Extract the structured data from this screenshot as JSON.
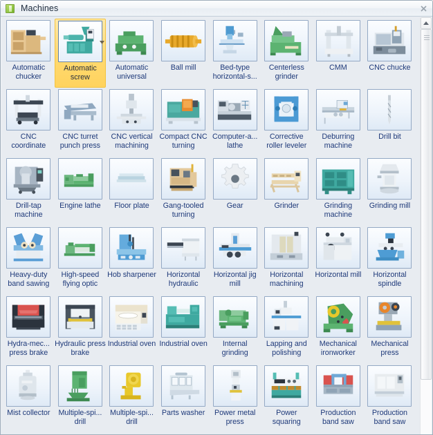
{
  "window": {
    "title": "Machines",
    "title_icon": "stencil-icon",
    "close_label": "close-icon"
  },
  "scrollbar": {
    "up_arrow": "scroll-up-icon",
    "thumb_grip": "scrollbar-grip"
  },
  "selection": {
    "selected_index": 1,
    "selected_label": "Automatic screw",
    "highlight_color": "#ffd970",
    "dropdown_arrow": "chevron-down-icon"
  },
  "colors": {
    "caption_text": "#1f3a7a",
    "panel_background": "#e8ecf1",
    "thumb_border": "#93a8c4",
    "title_text": "#1d2b3c"
  },
  "grid": {
    "columns": 8,
    "items": [
      {
        "label": "Automatic chucker",
        "icon": "automatic-chucker"
      },
      {
        "label": "Automatic screw",
        "icon": "automatic-screw"
      },
      {
        "label": "Automatic universal",
        "icon": "automatic-universal"
      },
      {
        "label": "Ball mill",
        "icon": "ball-mill"
      },
      {
        "label": "Bed-type horizontal-s...",
        "icon": "bed-type-horizontal"
      },
      {
        "label": "Centerless grinder",
        "icon": "centerless-grinder"
      },
      {
        "label": "CMM",
        "icon": "cmm"
      },
      {
        "label": "CNC chucke",
        "icon": "cnc-chucker"
      },
      {
        "label": "CNC coordinate",
        "icon": "cnc-coordinate"
      },
      {
        "label": "CNC turret punch press",
        "icon": "cnc-turret-punch-press"
      },
      {
        "label": "CNC vertical machining",
        "icon": "cnc-vertical-machining"
      },
      {
        "label": "Compact CNC turning",
        "icon": "compact-cnc-turning"
      },
      {
        "label": "Computer-a... lathe",
        "icon": "computer-aided-lathe"
      },
      {
        "label": "Corrective roller leveler",
        "icon": "corrective-roller-leveler"
      },
      {
        "label": "Deburring machine",
        "icon": "deburring-machine"
      },
      {
        "label": "Drill bit",
        "icon": "drill-bit"
      },
      {
        "label": "Drill-tap machine",
        "icon": "drill-tap-machine"
      },
      {
        "label": "Engine lathe",
        "icon": "engine-lathe"
      },
      {
        "label": "Floor plate",
        "icon": "floor-plate"
      },
      {
        "label": "Gang-tooled turning",
        "icon": "gang-tooled-turning"
      },
      {
        "label": "Gear",
        "icon": "gear"
      },
      {
        "label": "Grinder",
        "icon": "grinder"
      },
      {
        "label": "Grinding machine",
        "icon": "grinding-machine"
      },
      {
        "label": "Grinding mill",
        "icon": "grinding-mill"
      },
      {
        "label": "Heavy-duty band sawing",
        "icon": "heavy-duty-band-sawing"
      },
      {
        "label": "High-speed flying optic",
        "icon": "high-speed-flying-optic"
      },
      {
        "label": "Hob sharpener",
        "icon": "hob-sharpener"
      },
      {
        "label": "Horizontal hydraulic",
        "icon": "horizontal-hydraulic"
      },
      {
        "label": "Horizontal jig mill",
        "icon": "horizontal-jig-mill"
      },
      {
        "label": "Horizontal machining",
        "icon": "horizontal-machining"
      },
      {
        "label": "Horizontal mill",
        "icon": "horizontal-mill"
      },
      {
        "label": "Horizontal spindle",
        "icon": "horizontal-spindle"
      },
      {
        "label": "Hydra-mec... press brake",
        "icon": "hydra-mechanical-press-brake"
      },
      {
        "label": "Hydraulic press brake",
        "icon": "hydraulic-press-brake"
      },
      {
        "label": "Industrial oven",
        "icon": "industrial-oven-1"
      },
      {
        "label": "Industrial oven",
        "icon": "industrial-oven-2"
      },
      {
        "label": "Internal grinding",
        "icon": "internal-grinding"
      },
      {
        "label": "Lapping and polishing",
        "icon": "lapping-and-polishing"
      },
      {
        "label": "Mechanical ironworker",
        "icon": "mechanical-ironworker"
      },
      {
        "label": "Mechanical press",
        "icon": "mechanical-press"
      },
      {
        "label": "Mist collector",
        "icon": "mist-collector"
      },
      {
        "label": "Multiple-spi... drill",
        "icon": "multiple-spindle-drill-1"
      },
      {
        "label": "Multiple-spi... drill",
        "icon": "multiple-spindle-drill-2"
      },
      {
        "label": "Parts washer",
        "icon": "parts-washer"
      },
      {
        "label": "Power metal press",
        "icon": "power-metal-press"
      },
      {
        "label": "Power squaring",
        "icon": "power-squaring"
      },
      {
        "label": "Production band saw",
        "icon": "production-band-saw-1"
      },
      {
        "label": "Production band saw",
        "icon": "production-band-saw-2"
      }
    ]
  }
}
